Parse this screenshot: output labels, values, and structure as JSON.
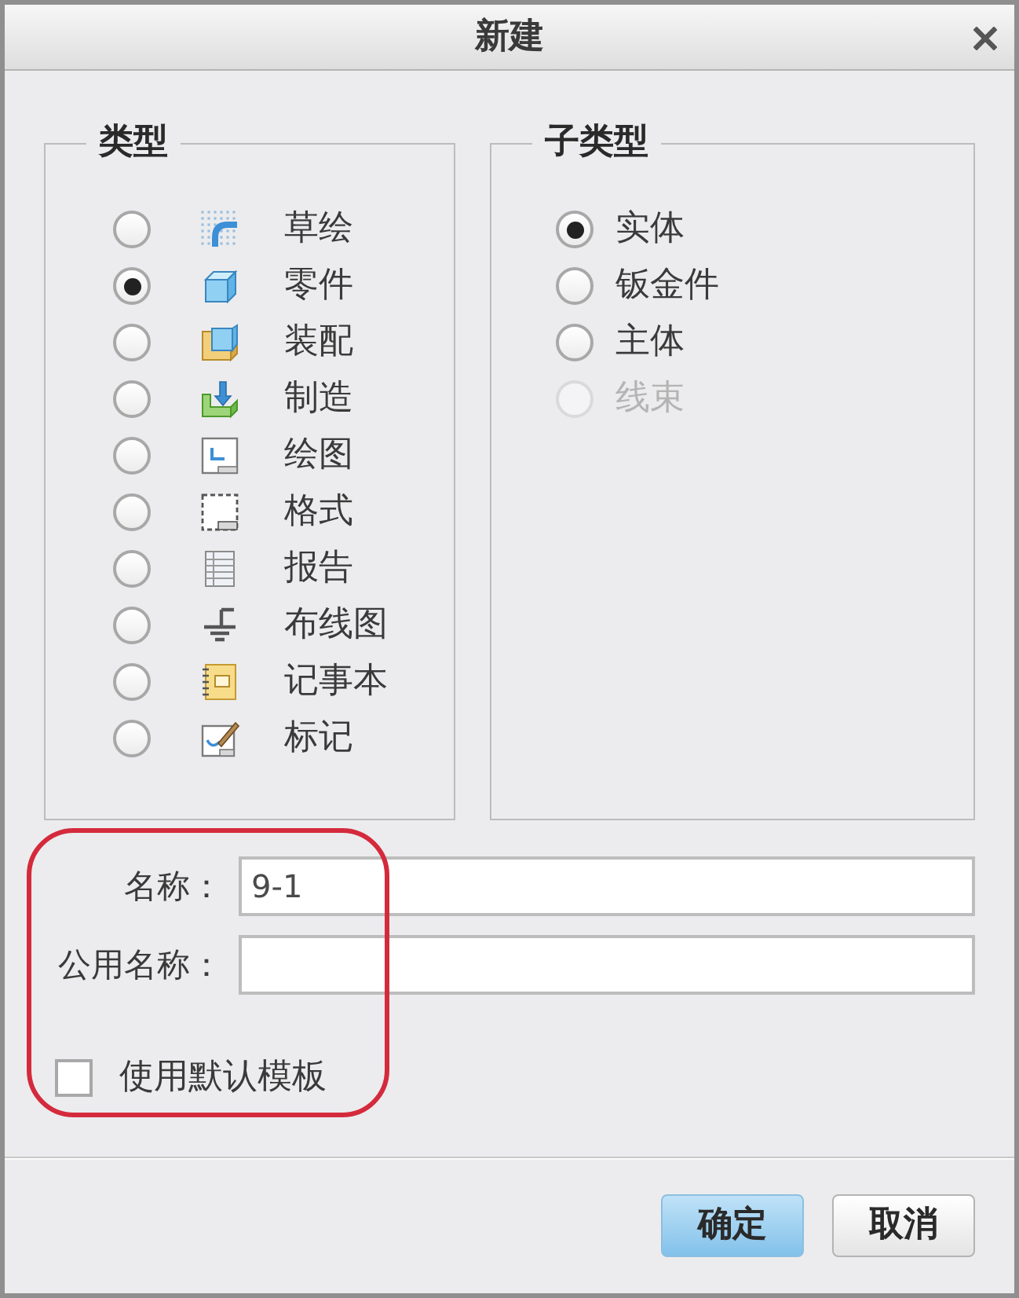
{
  "window": {
    "title": "新建"
  },
  "type_group": {
    "title": "类型",
    "options": [
      {
        "label": "草绘",
        "selected": false
      },
      {
        "label": "零件",
        "selected": true
      },
      {
        "label": "装配",
        "selected": false
      },
      {
        "label": "制造",
        "selected": false
      },
      {
        "label": "绘图",
        "selected": false
      },
      {
        "label": "格式",
        "selected": false
      },
      {
        "label": "报告",
        "selected": false
      },
      {
        "label": "布线图",
        "selected": false
      },
      {
        "label": "记事本",
        "selected": false
      },
      {
        "label": "标记",
        "selected": false
      }
    ]
  },
  "subtype_group": {
    "title": "子类型",
    "options": [
      {
        "label": "实体",
        "selected": true,
        "disabled": false
      },
      {
        "label": "钣金件",
        "selected": false,
        "disabled": false
      },
      {
        "label": "主体",
        "selected": false,
        "disabled": false
      },
      {
        "label": "线束",
        "selected": false,
        "disabled": true
      }
    ]
  },
  "fields": [
    {
      "label": "名称：",
      "value": "9-1"
    },
    {
      "label": "公用名称："
    }
  ],
  "use_default_template": {
    "label": "使用默认模板",
    "checked": false
  },
  "buttons": [
    {
      "label": "确定",
      "default": true
    },
    {
      "label": "取消",
      "default": false
    }
  ]
}
